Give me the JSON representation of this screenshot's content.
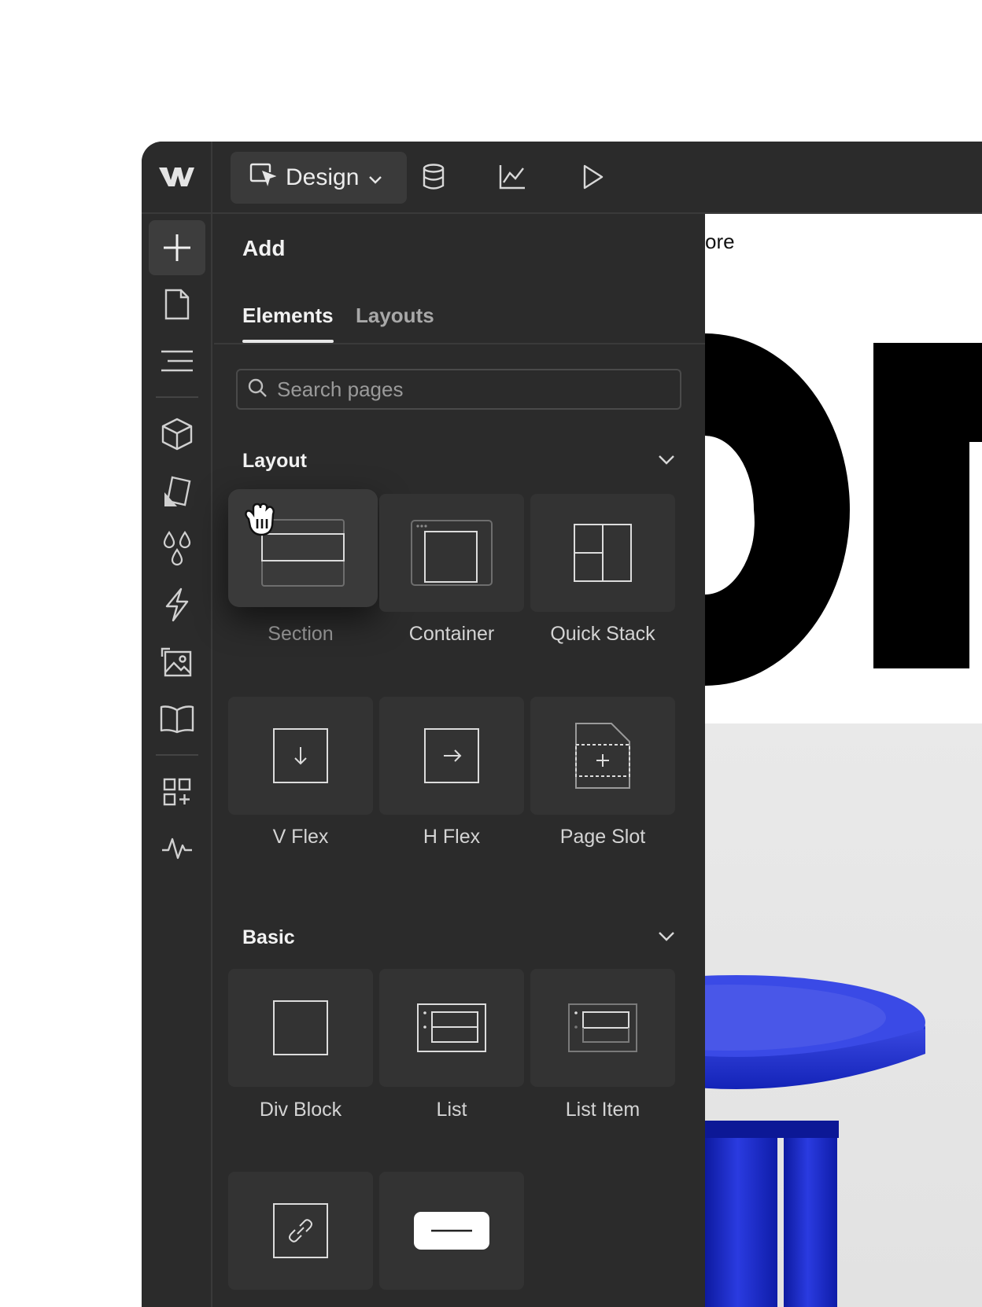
{
  "toolbar": {
    "mode_label": "Design",
    "icons": [
      "webflow-logo-icon",
      "cursor-select-icon",
      "chevron-down-icon",
      "database-icon",
      "analytics-icon",
      "play-icon"
    ]
  },
  "rail": {
    "icons": [
      "add-icon",
      "pages-icon",
      "navigator-icon",
      "components-icon",
      "style-selectors-icon",
      "variables-icon",
      "interactions-icon",
      "assets-icon",
      "cms-book-icon",
      "apps-icon",
      "audit-icon"
    ]
  },
  "panel": {
    "title": "Add",
    "tabs": [
      {
        "label": "Elements",
        "active": true
      },
      {
        "label": "Layouts",
        "active": false
      }
    ],
    "search": {
      "placeholder": "Search pages",
      "value": ""
    },
    "sections": [
      {
        "title": "Layout",
        "items": [
          "Section",
          "Container",
          "Quick Stack",
          "V Flex",
          "H Flex",
          "Page Slot"
        ]
      },
      {
        "title": "Basic",
        "items": [
          "Div Block",
          "List",
          "List Item",
          "Link Block",
          "Button"
        ]
      }
    ]
  },
  "canvas": {
    "nav_text": "ore",
    "product_color": "#1a2bd0"
  }
}
